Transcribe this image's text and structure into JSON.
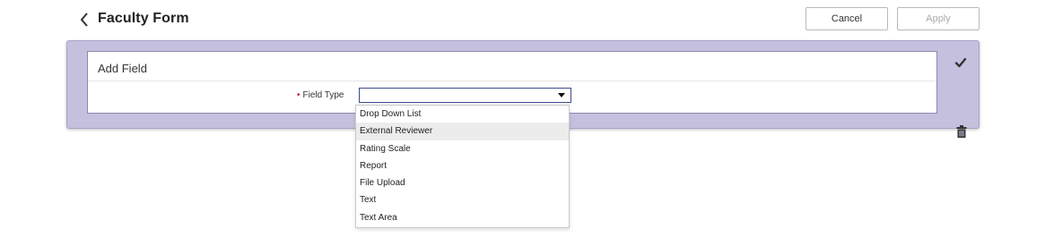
{
  "header": {
    "title": "Faculty Form",
    "back_icon": "chevron-left-icon",
    "cancel_label": "Cancel",
    "apply_label": "Apply"
  },
  "panel": {
    "title": "Add Field",
    "field": {
      "label": "Field Type",
      "required_marker": "•",
      "value": ""
    },
    "actions": {
      "confirm_icon": "check-icon",
      "delete_icon": "trash-icon"
    }
  },
  "dropdown": {
    "options": [
      "Drop Down List",
      "External Reviewer",
      "Rating Scale",
      "Report",
      "File Upload",
      "Text",
      "Text Area"
    ],
    "highlighted": "External Reviewer"
  },
  "colors": {
    "panel_background": "#c5c0de",
    "select_border": "#3d4a8c",
    "required": "#c8102e"
  }
}
